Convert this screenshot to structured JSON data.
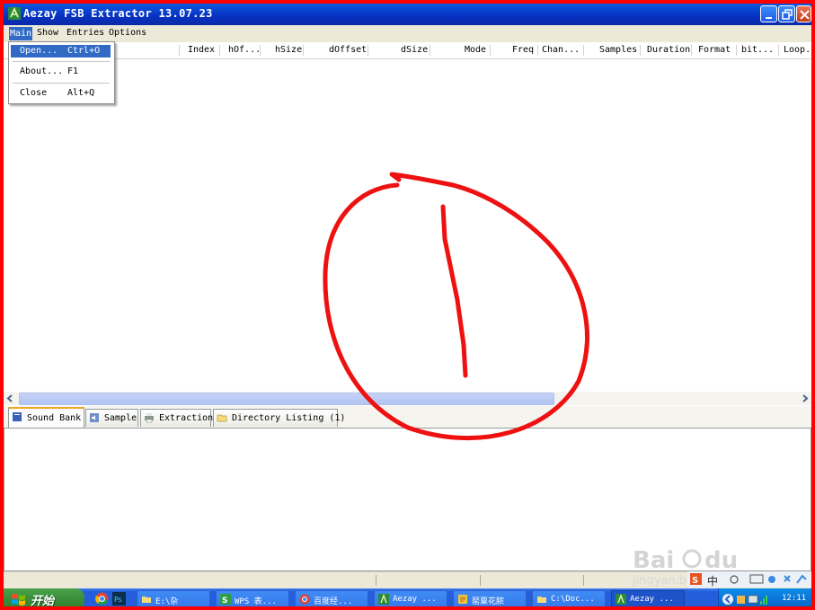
{
  "window": {
    "title": "Aezay FSB Extractor 13.07.23",
    "buttons": {
      "minimize_icon": "minimize-icon",
      "restore_icon": "restore-icon",
      "close_icon": "close-icon"
    }
  },
  "menubar": {
    "items": [
      {
        "label": "Main",
        "active": true
      },
      {
        "label": "Show"
      },
      {
        "label": "Entries"
      },
      {
        "label": "Options"
      }
    ]
  },
  "dropdown": {
    "items": [
      {
        "label": "Open...",
        "shortcut": "Ctrl+O",
        "highlighted": true
      },
      {
        "label": "About...",
        "shortcut": "F1"
      },
      {
        "label": "Close",
        "shortcut": "Alt+Q"
      }
    ]
  },
  "list": {
    "columns": [
      "Index",
      "hOf...",
      "hSize",
      "dOffset",
      "dSize",
      "Mode",
      "Freq",
      "Chan...",
      "Samples",
      "Duration",
      "Format",
      "bit...",
      "Loop..."
    ]
  },
  "tabs": [
    {
      "label": "Sound Bank",
      "icon": "book-icon",
      "active": true
    },
    {
      "label": "Sample",
      "icon": "speaker-icon"
    },
    {
      "label": "Extraction",
      "icon": "printer-icon"
    },
    {
      "label": "Directory Listing (1)",
      "icon": "folder-icon"
    }
  ],
  "annotation": {
    "text": "1",
    "color": "#ee1111"
  },
  "taskbar": {
    "start_label": "开始",
    "tasks": [
      {
        "label": "E:\\杂",
        "icon": "folder-icon"
      },
      {
        "label": "WPS 表...",
        "icon": "wps-icon"
      },
      {
        "label": "百度经...",
        "icon": "chrome-icon"
      },
      {
        "label": "Aezay ...",
        "icon": "app-icon"
      },
      {
        "label": "罂粟花脓",
        "icon": "note-icon"
      },
      {
        "label": "C:\\Doc...",
        "icon": "folder-icon"
      },
      {
        "label": "Aezay ...",
        "icon": "app-icon",
        "active": true
      }
    ],
    "clock": "12:11",
    "ime": "中"
  },
  "watermark": {
    "brand": "Baidu经验",
    "url": "jingyan.baidu.com"
  },
  "colors": {
    "titlebar": "#0a46d6",
    "menu_highlight": "#316ac5",
    "frame": "#ff0000",
    "taskbar": "#245edb"
  }
}
